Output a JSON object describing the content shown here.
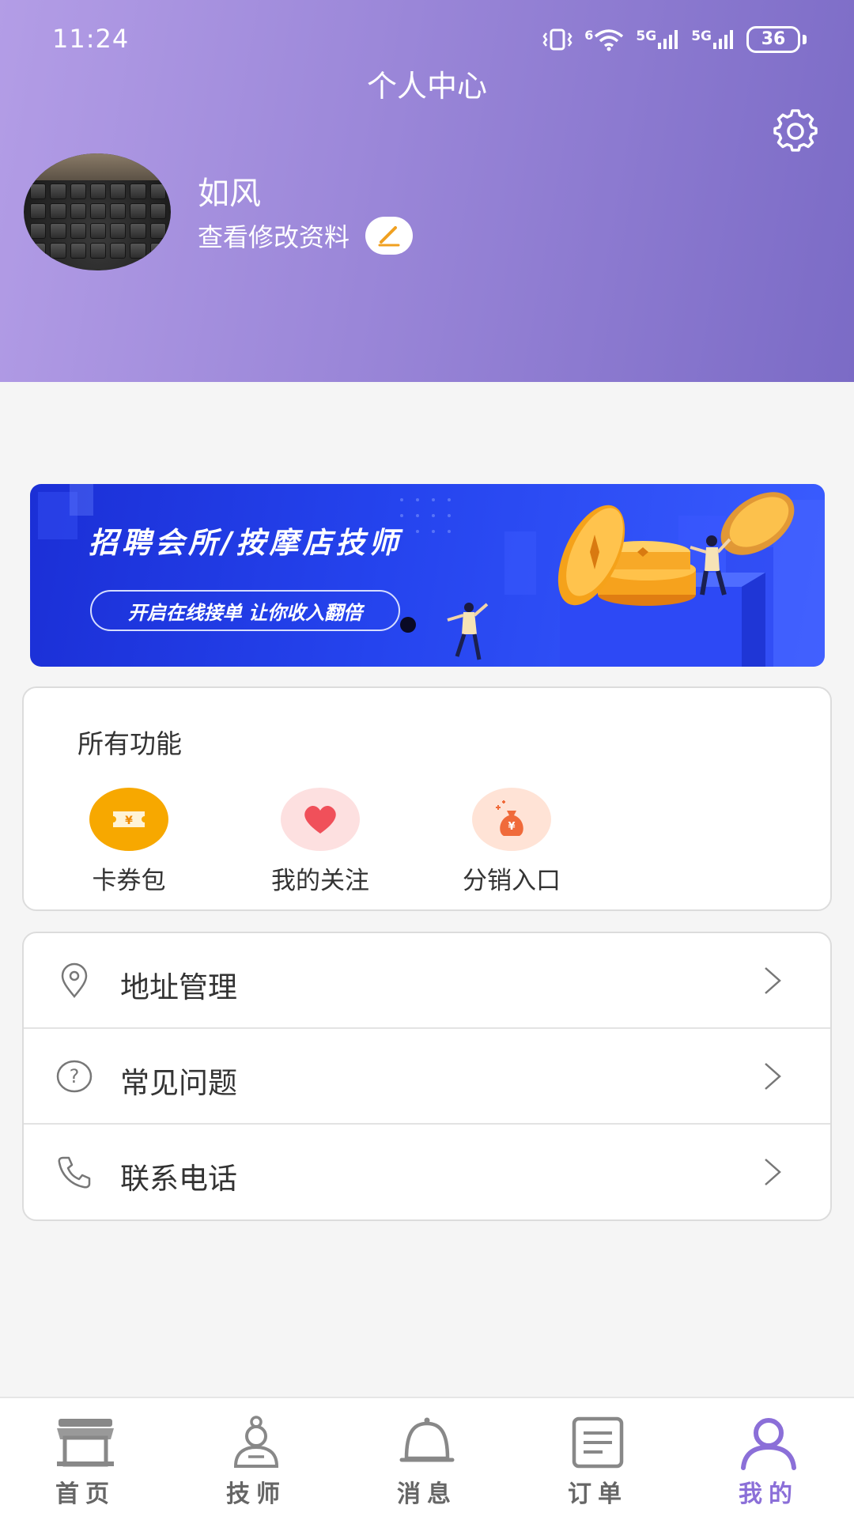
{
  "status_bar": {
    "time": "11:24",
    "wifi_badge": "6",
    "signal1": "5G",
    "signal2": "5G",
    "battery": "36"
  },
  "header": {
    "title": "个人中心",
    "user_name": "如风",
    "edit_profile": "查看修改资料"
  },
  "banner": {
    "title": "招聘会所/按摩店技师",
    "subtitle": "开启在线接单 让你收入翻倍"
  },
  "functions": {
    "title": "所有功能",
    "items": [
      {
        "label": "卡券包",
        "icon": "coupon-icon"
      },
      {
        "label": "我的关注",
        "icon": "heart-icon"
      },
      {
        "label": "分销入口",
        "icon": "money-bag-icon"
      }
    ]
  },
  "menu": [
    {
      "label": "地址管理",
      "icon": "location-pin-icon"
    },
    {
      "label": "常见问题",
      "icon": "question-icon"
    },
    {
      "label": "联系电话",
      "icon": "phone-icon"
    }
  ],
  "tabbar": {
    "items": [
      {
        "label": "首页",
        "icon": "store-icon"
      },
      {
        "label": "技师",
        "icon": "technician-icon"
      },
      {
        "label": "消息",
        "icon": "bell-icon"
      },
      {
        "label": "订单",
        "icon": "order-icon"
      },
      {
        "label": "我的",
        "icon": "user-icon"
      }
    ],
    "active_index": 4
  },
  "colors": {
    "header_start": "#b39de6",
    "header_end": "#7b6bc6",
    "accent": "#8b6fd8",
    "banner_blue": "#2544ee",
    "coupon_yellow": "#f7a800"
  }
}
